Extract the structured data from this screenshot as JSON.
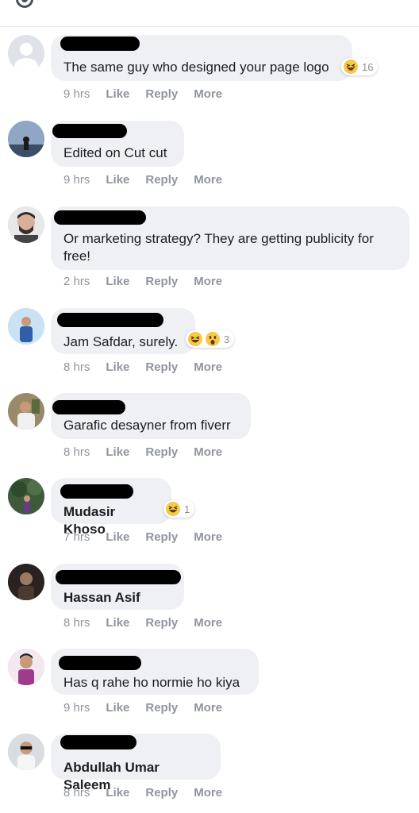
{
  "comments": [
    {
      "text": "The same guy who designed your page logo",
      "time": "9 hrs",
      "like": "Like",
      "reply": "Reply",
      "more": "More",
      "reaction_count": "16"
    },
    {
      "text": "Edited on Cut cut",
      "time": "9 hrs",
      "like": "Like",
      "reply": "Reply",
      "more": "More"
    },
    {
      "text": "Or marketing strategy? They are getting publicity for free!",
      "time": "2 hrs",
      "like": "Like",
      "reply": "Reply",
      "more": "More"
    },
    {
      "text": "Jam Safdar, surely.",
      "time": "8 hrs",
      "like": "Like",
      "reply": "Reply",
      "more": "More",
      "reaction_count": "3"
    },
    {
      "text": "Garafic desayner from fiverr",
      "time": "8 hrs",
      "like": "Like",
      "reply": "Reply",
      "more": "More"
    },
    {
      "text": "Mudasir Khoso",
      "time": "7 hrs",
      "like": "Like",
      "reply": "Reply",
      "more": "More",
      "reaction_count": "1"
    },
    {
      "text": "Hassan Asif",
      "time": "8 hrs",
      "like": "Like",
      "reply": "Reply",
      "more": "More"
    },
    {
      "text": "Has q rahe ho normie ho kiya",
      "time": "9 hrs",
      "like": "Like",
      "reply": "Reply",
      "more": "More"
    },
    {
      "text": "Abdullah Umar Saleem",
      "time": "8 hrs",
      "like": "Like",
      "reply": "Reply",
      "more": "More"
    }
  ],
  "colors": {
    "bubble": "#eef0f3",
    "action": "#90949c",
    "text": "#1c1e21"
  }
}
